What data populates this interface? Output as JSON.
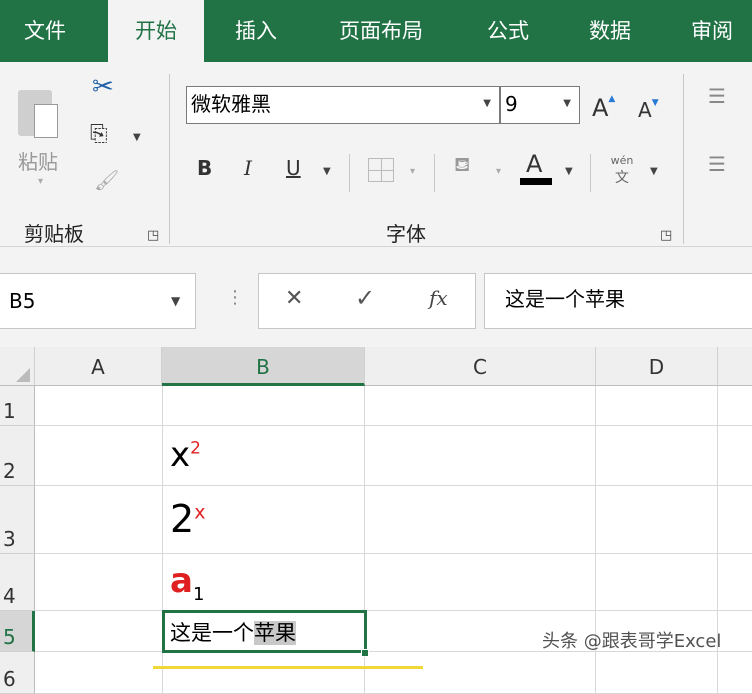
{
  "tabs": [
    "文件",
    "开始",
    "插入",
    "页面布局",
    "公式",
    "数据",
    "审阅"
  ],
  "ribbon": {
    "paste_label": "粘贴",
    "clipboard_group": "剪贴板",
    "font_group": "字体",
    "font_name": "微软雅黑",
    "font_size": "9",
    "bold": "B",
    "italic": "I",
    "underline": "U",
    "font_color_glyph": "A",
    "grow": "A",
    "shrink": "A",
    "phonetic_top": "wén",
    "phonetic_bottom": "文",
    "font_color": "#000000"
  },
  "formula_bar": {
    "name_box": "B5",
    "cancel": "✕",
    "enter": "✓",
    "fx": "fx",
    "content": "这是一个苹果"
  },
  "columns": [
    "A",
    "B",
    "C",
    "D"
  ],
  "rows": [
    "1",
    "2",
    "3",
    "4",
    "5",
    "6"
  ],
  "cells": {
    "B2": {
      "base": "x",
      "sup": "2"
    },
    "B3": {
      "base": "2",
      "sup": "x"
    },
    "B4": {
      "base": "a",
      "sub": "1"
    },
    "B5": {
      "normal": "这是一个",
      "selected": "苹果"
    }
  },
  "watermark": "头条 @跟表哥学Excel",
  "colors": {
    "accent": "#217346",
    "red": "#e02020"
  }
}
